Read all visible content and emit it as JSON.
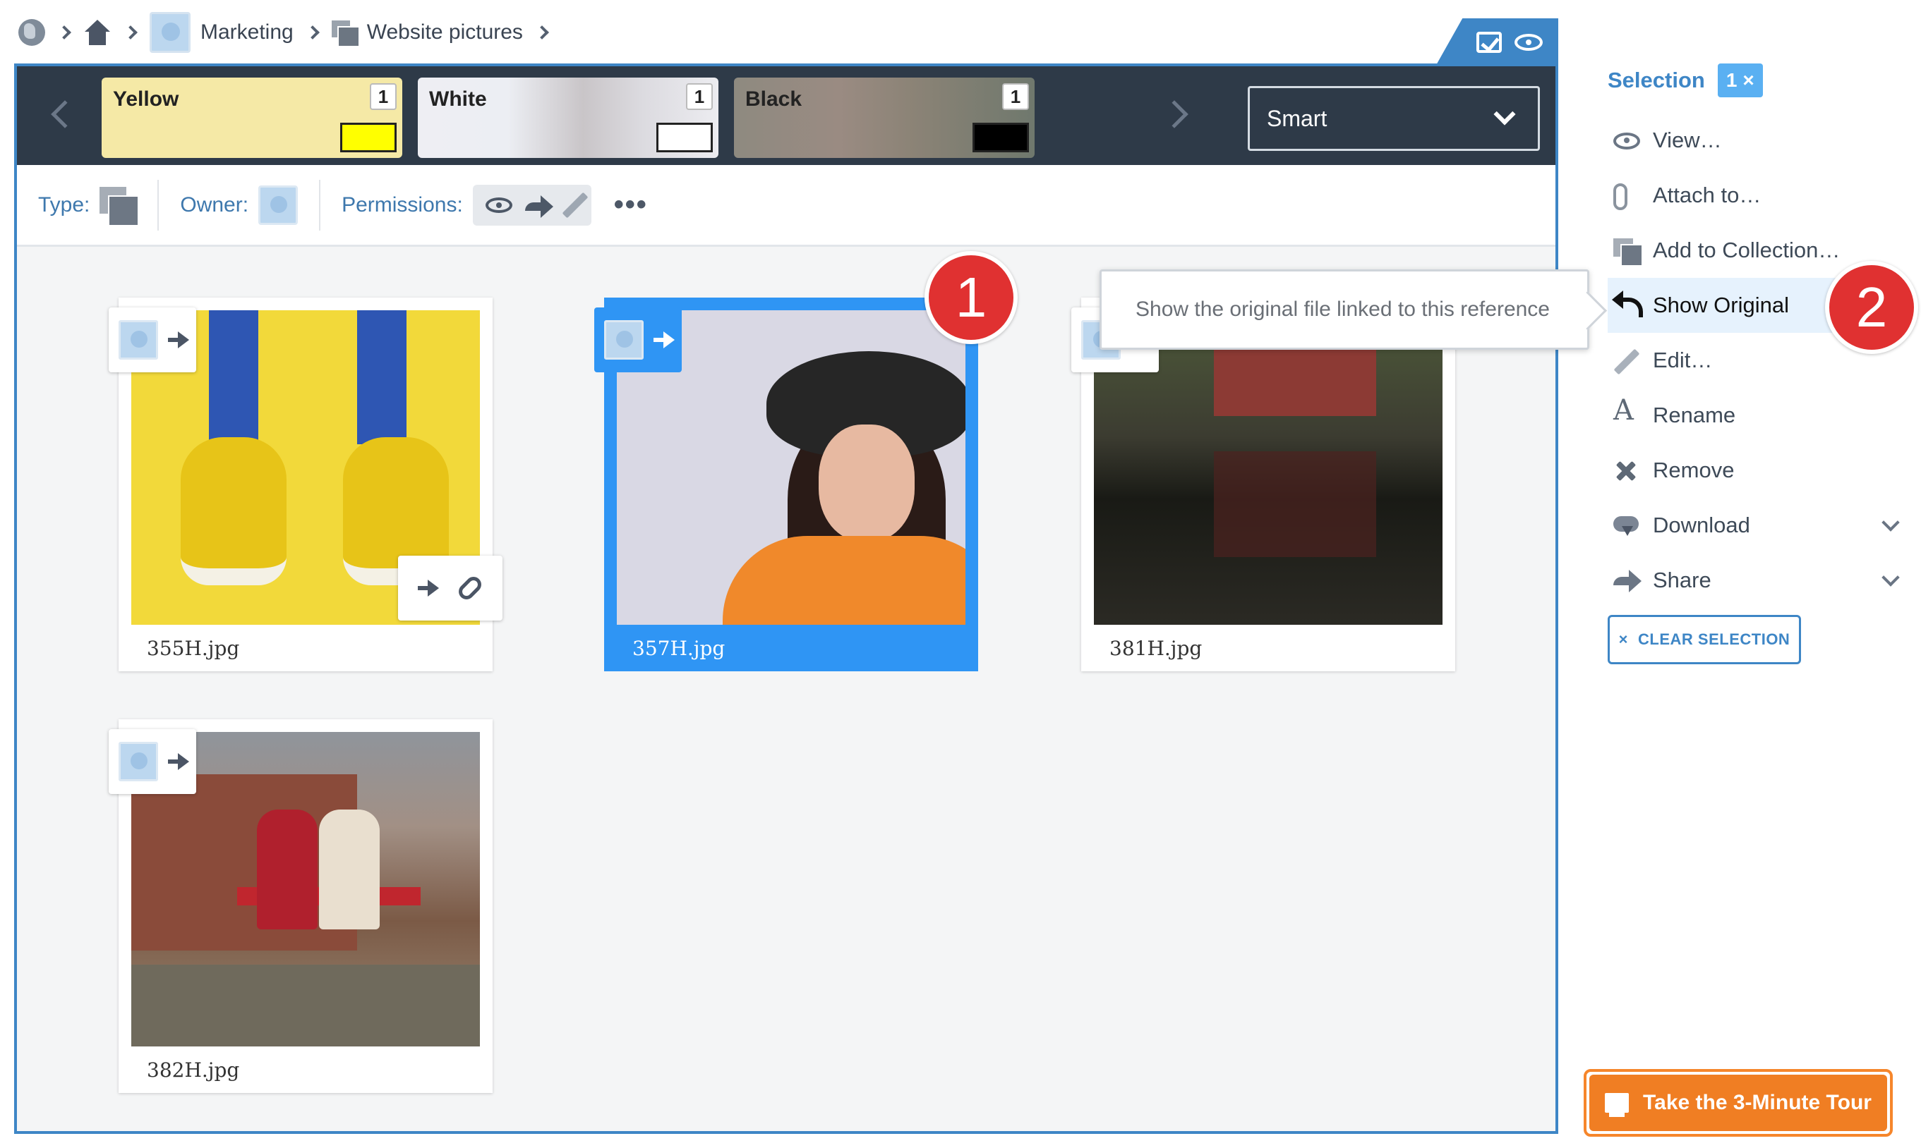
{
  "breadcrumb": {
    "items": [
      "Marketing",
      "Website pictures"
    ]
  },
  "color_filters": [
    {
      "name": "Yellow",
      "count": "1",
      "color": "#ffff00"
    },
    {
      "name": "White",
      "count": "1",
      "color": "#ffffff"
    },
    {
      "name": "Black",
      "count": "1",
      "color": "#000000"
    }
  ],
  "sort": {
    "selected": "Smart"
  },
  "filter_bar": {
    "type_label": "Type:",
    "owner_label": "Owner:",
    "permissions_label": "Permissions:",
    "more": "•••"
  },
  "files": [
    {
      "name": "355H.jpg",
      "selected": false
    },
    {
      "name": "357H.jpg",
      "selected": true
    },
    {
      "name": "381H.jpg",
      "selected": false
    },
    {
      "name": "382H.jpg",
      "selected": false
    }
  ],
  "markers": [
    "1",
    "2"
  ],
  "tooltip": {
    "text": "Show the original file linked to this reference"
  },
  "sidebar": {
    "selection_label": "Selection",
    "selection_count": "1",
    "selection_clear_glyph": "×",
    "items": [
      {
        "label": "View…",
        "icon": "eye-icon"
      },
      {
        "label": "Attach to…",
        "icon": "paperclip-icon"
      },
      {
        "label": "Add to Collection…",
        "icon": "collection-icon"
      },
      {
        "label": "Show Original",
        "icon": "undo-icon"
      },
      {
        "label": "Edit…",
        "icon": "pencil-icon"
      },
      {
        "label": "Rename",
        "icon": "rename-icon"
      },
      {
        "label": "Remove",
        "icon": "close-icon"
      },
      {
        "label": "Download",
        "icon": "cloud-download-icon"
      },
      {
        "label": "Share",
        "icon": "share-icon"
      }
    ],
    "clear_selection": "CLEAR SELECTION"
  },
  "tour": {
    "label": "Take the 3-Minute Tour"
  },
  "colors": {
    "accent": "#3e86c6",
    "selected_card": "#2f95f4",
    "marker": "#e03131",
    "tour": "#f07e23"
  }
}
